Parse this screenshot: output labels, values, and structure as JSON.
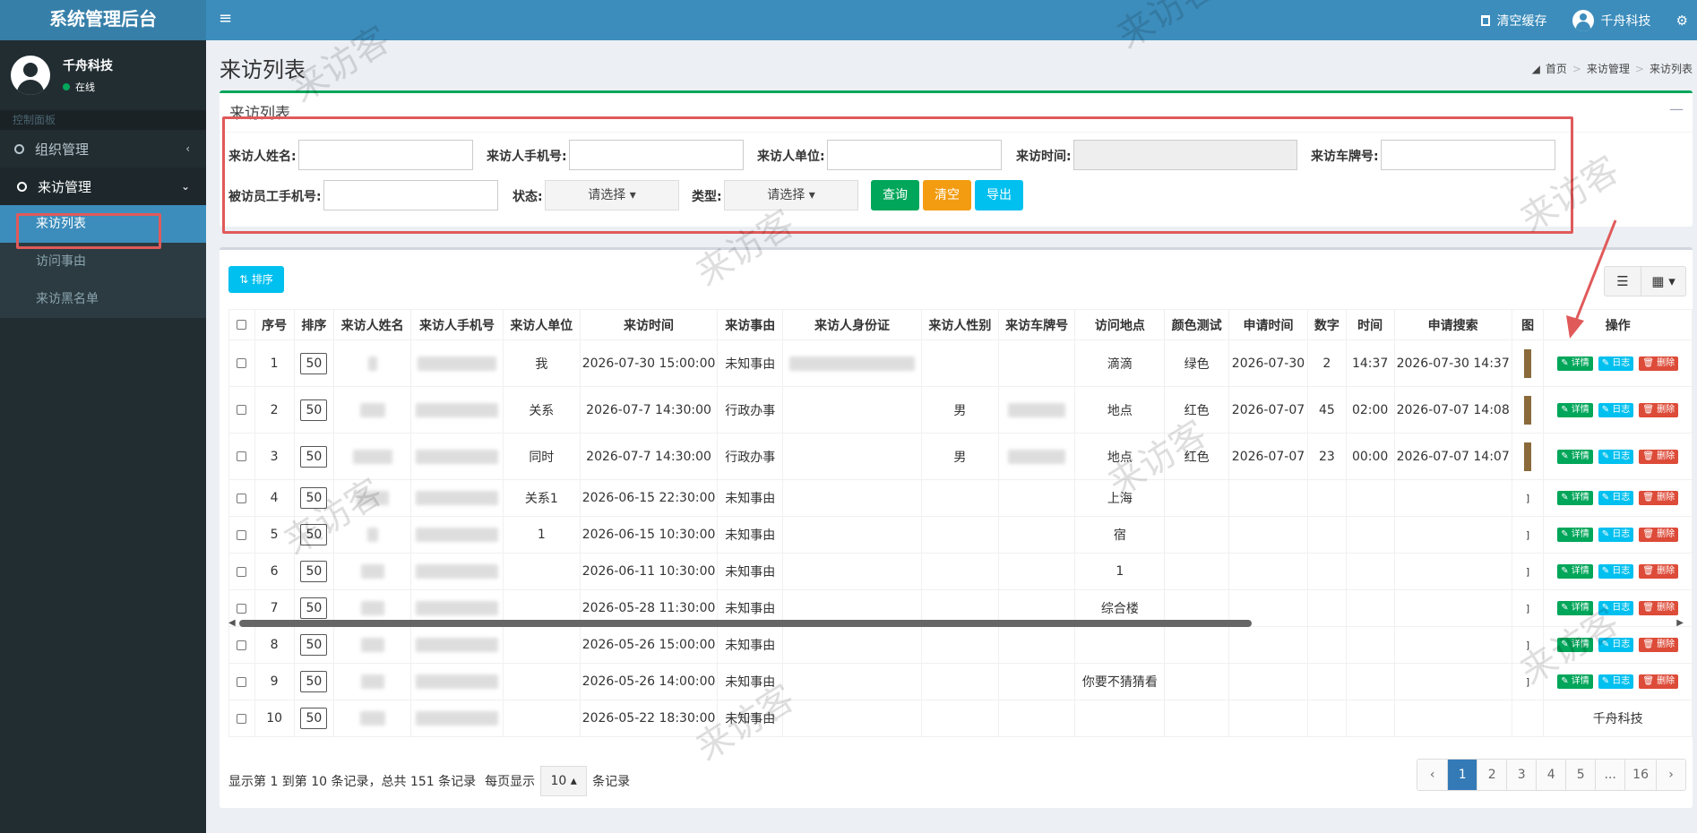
{
  "app": {
    "title": "系统管理后台"
  },
  "user": {
    "name": "千舟科技",
    "status": "在线"
  },
  "sidebar": {
    "header": "控制面板",
    "items": [
      {
        "label": "组织管理",
        "chevron": "‹"
      },
      {
        "label": "来访管理",
        "chevron": "⌄"
      }
    ],
    "sub_items": [
      "来访列表",
      "访问事由",
      "来访黑名单"
    ]
  },
  "topbar": {
    "clear_cache": "清空缓存",
    "user": "千舟科技",
    "menu_icon": "≡",
    "gear_icon": "⚙"
  },
  "page": {
    "title": "来访列表",
    "breadcrumb": [
      "首页",
      "来访管理",
      "来访列表"
    ]
  },
  "search": {
    "box_title": "来访列表",
    "labels": {
      "name": "来访人姓名:",
      "phone": "来访人手机号:",
      "company": "来访人单位:",
      "time": "来访时间:",
      "plate": "来访车牌号:",
      "emp_phone": "被访员工手机号:",
      "status": "状态:",
      "type": "类型:"
    },
    "select_placeholder": "请选择 ▾",
    "buttons": {
      "query": "查询",
      "clear": "清空",
      "export": "导出"
    }
  },
  "table": {
    "sort_button": "⇅ 排序",
    "columns": [
      "",
      "序号",
      "排序",
      "来访人姓名",
      "来访人手机号",
      "来访人单位",
      "来访时间",
      "来访事由",
      "来访人身份证",
      "来访人性别",
      "来访车牌号",
      "访问地点",
      "颜色测试",
      "申请时间",
      "数字",
      "时间",
      "申请搜索",
      "图",
      "操作"
    ],
    "op_labels": {
      "detail": "✎ 详情",
      "log": "✎ 日志",
      "delete": "🗑 删除"
    },
    "rows": [
      {
        "no": "1",
        "sort": "50",
        "company": "我",
        "time": "2026-07-30 15:00:00",
        "reason": "未知事由",
        "gender": "",
        "place": "滴滴",
        "color": "绿色",
        "apply_date": "2026-07-30",
        "num": "2",
        "clock": "14:37",
        "search": "2026-07-30 14:37"
      },
      {
        "no": "2",
        "sort": "50",
        "company": "关系",
        "time": "2026-07-7 14:30:00",
        "reason": "行政办事",
        "gender": "男",
        "place": "地点",
        "color": "红色",
        "apply_date": "2026-07-07",
        "num": "45",
        "clock": "02:00",
        "search": "2026-07-07 14:08"
      },
      {
        "no": "3",
        "sort": "50",
        "company": "同时",
        "time": "2026-07-7 14:30:00",
        "reason": "行政办事",
        "gender": "男",
        "place": "地点",
        "color": "红色",
        "apply_date": "2026-07-07",
        "num": "23",
        "clock": "00:00",
        "search": "2026-07-07 14:07"
      },
      {
        "no": "4",
        "sort": "50",
        "company": "关系1",
        "time": "2026-06-15 22:30:00",
        "reason": "未知事由",
        "gender": "",
        "place": "上海",
        "color": "",
        "apply_date": "",
        "num": "",
        "clock": "",
        "search": ""
      },
      {
        "no": "5",
        "sort": "50",
        "company": "1",
        "time": "2026-06-15 10:30:00",
        "reason": "未知事由",
        "gender": "",
        "place": "宿",
        "color": "",
        "apply_date": "",
        "num": "",
        "clock": "",
        "search": ""
      },
      {
        "no": "6",
        "sort": "50",
        "company": "",
        "time": "2026-06-11 10:30:00",
        "reason": "未知事由",
        "gender": "",
        "place": "1",
        "color": "",
        "apply_date": "",
        "num": "",
        "clock": "",
        "search": ""
      },
      {
        "no": "7",
        "sort": "50",
        "company": "",
        "time": "2026-05-28 11:30:00",
        "reason": "未知事由",
        "gender": "",
        "place": "综合楼",
        "color": "",
        "apply_date": "",
        "num": "",
        "clock": "",
        "search": ""
      },
      {
        "no": "8",
        "sort": "50",
        "company": "",
        "time": "2026-05-26 15:00:00",
        "reason": "未知事由",
        "gender": "",
        "place": "",
        "color": "",
        "apply_date": "",
        "num": "",
        "clock": "",
        "search": ""
      },
      {
        "no": "9",
        "sort": "50",
        "company": "",
        "time": "2026-05-26 14:00:00",
        "reason": "未知事由",
        "gender": "",
        "place": "你要不猜猜看",
        "color": "",
        "apply_date": "",
        "num": "",
        "clock": "",
        "search": ""
      },
      {
        "no": "10",
        "sort": "50",
        "company": "",
        "time": "2026-05-22 18:30:00",
        "reason": "未知事由",
        "gender": "",
        "place": "",
        "color": "",
        "apply_date": "",
        "num": "",
        "clock": "",
        "search": ""
      }
    ],
    "last_row_op_text": "千舟科技"
  },
  "footer": {
    "summary": "显示第 1 到第 10 条记录，总共 151 条记录",
    "per_page_prefix": "每页显示",
    "per_page_value": "10 ▴",
    "per_page_suffix": "条记录"
  },
  "pagination": [
    "‹",
    "1",
    "2",
    "3",
    "4",
    "5",
    "...",
    "16",
    "›"
  ],
  "watermark": "来访客",
  "colors": {
    "sidebar": "#222d32",
    "brand": "#3c8dbc",
    "logo": "#367fa9",
    "success": "#00a65a",
    "warning": "#f39c12",
    "info": "#00c0ef",
    "danger": "#dd4b39",
    "highlight": "#e05a5a"
  }
}
